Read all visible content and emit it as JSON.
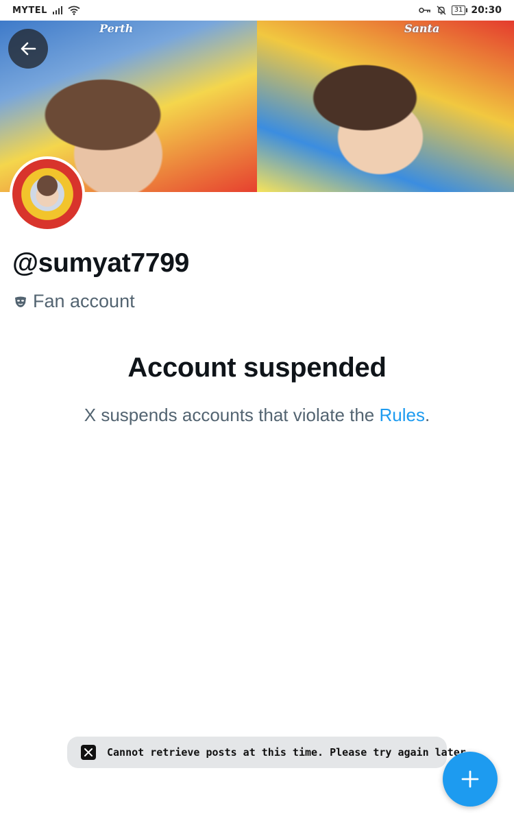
{
  "status_bar": {
    "carrier": "MYTEL",
    "battery": "31",
    "time": "20:30",
    "icons": [
      "signal-icon",
      "wifi-icon",
      "key-icon",
      "mute-icon",
      "battery-icon"
    ]
  },
  "banner": {
    "text_left": "Perth",
    "text_right": "Santa"
  },
  "profile": {
    "handle": "@sumyat7799",
    "badge_label": "Fan account",
    "badge_icon": "mask-icon"
  },
  "suspension": {
    "title": "Account suspended",
    "description_prefix": "X suspends accounts that violate the ",
    "rules_link": "Rules",
    "description_suffix": "."
  },
  "toast": {
    "icon": "x-logo-icon",
    "message": "Cannot retrieve posts at this time. Please try again later."
  },
  "fab": {
    "icon": "plus-icon"
  },
  "colors": {
    "accent": "#1d9bf0",
    "text_primary": "#0f1419",
    "text_secondary": "#536471",
    "toast_bg": "#e4e6e8"
  }
}
